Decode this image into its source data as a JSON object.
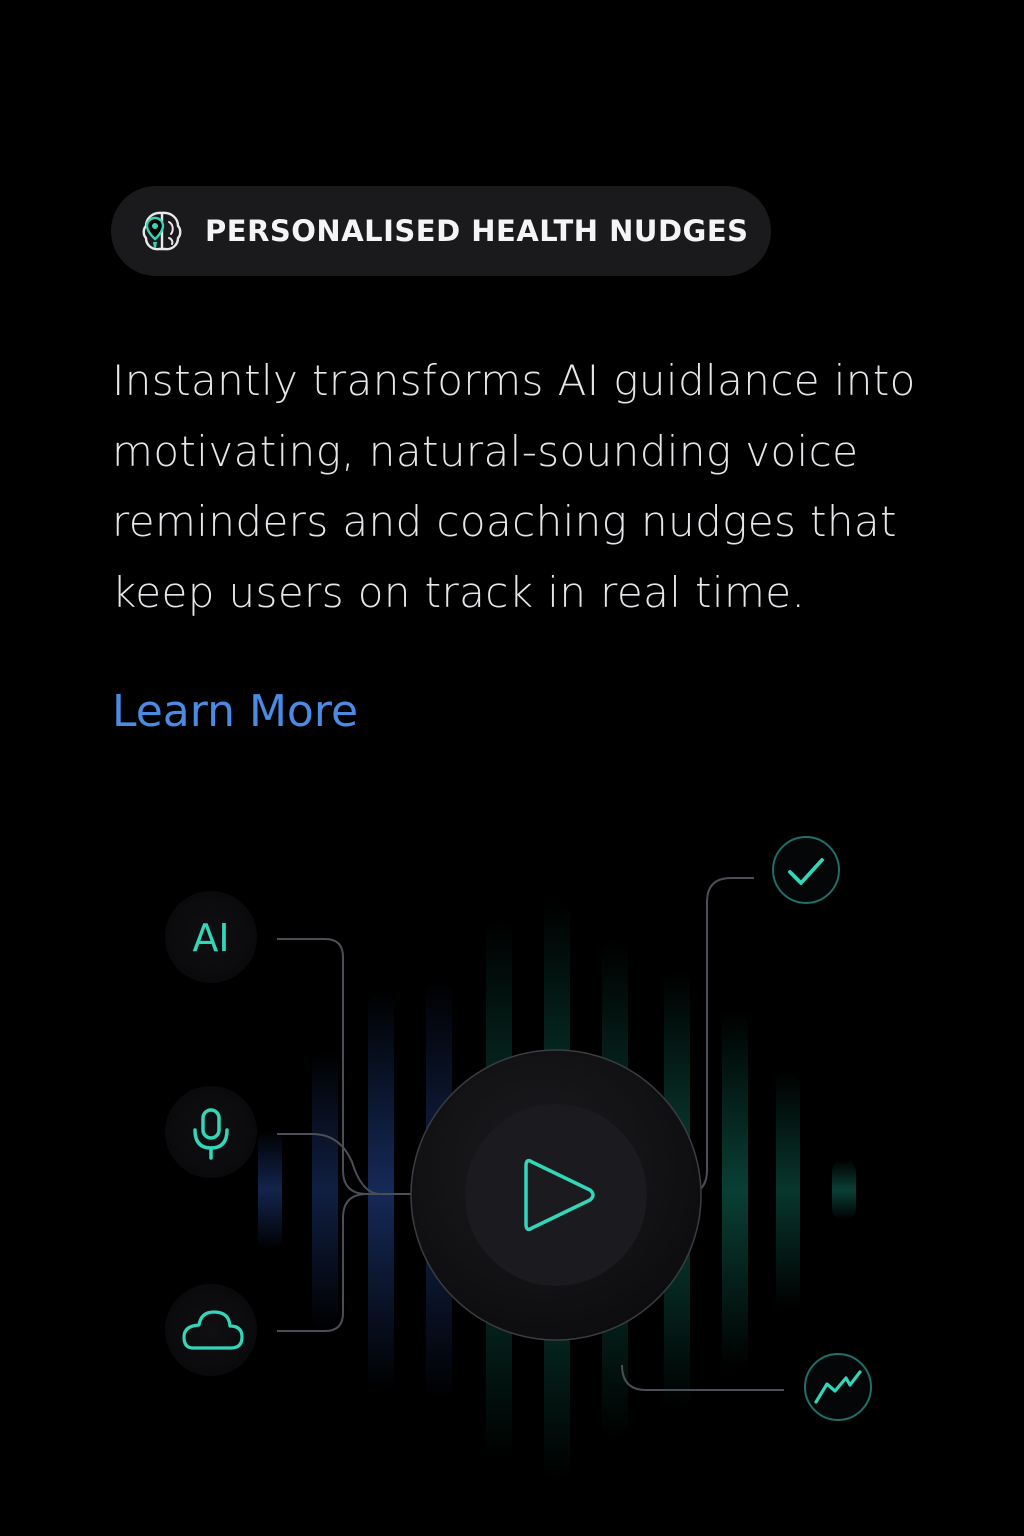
{
  "badge": {
    "label": "PERSONALISED HEALTH NUDGES",
    "icon": "brain-location-pin-icon"
  },
  "description": "Instantly transforms AI guidlance into motivating, natural-sounding voice reminders and coaching nudges that keep users on track in real time.",
  "link": {
    "label": "Learn More",
    "color": "#4a8be4"
  },
  "illustration": {
    "input_nodes": [
      {
        "label": "AI",
        "icon": "ai-text-icon"
      },
      {
        "label": "",
        "icon": "microphone-icon"
      },
      {
        "label": "",
        "icon": "cloud-icon"
      }
    ],
    "center": {
      "icon": "play-icon"
    },
    "output_nodes": [
      {
        "icon": "checkmark-icon"
      },
      {
        "icon": "trend-line-icon"
      }
    ],
    "accent_color": "#33d6b8",
    "wave_colors": [
      "#1e3a7a",
      "#0f6a58"
    ]
  }
}
